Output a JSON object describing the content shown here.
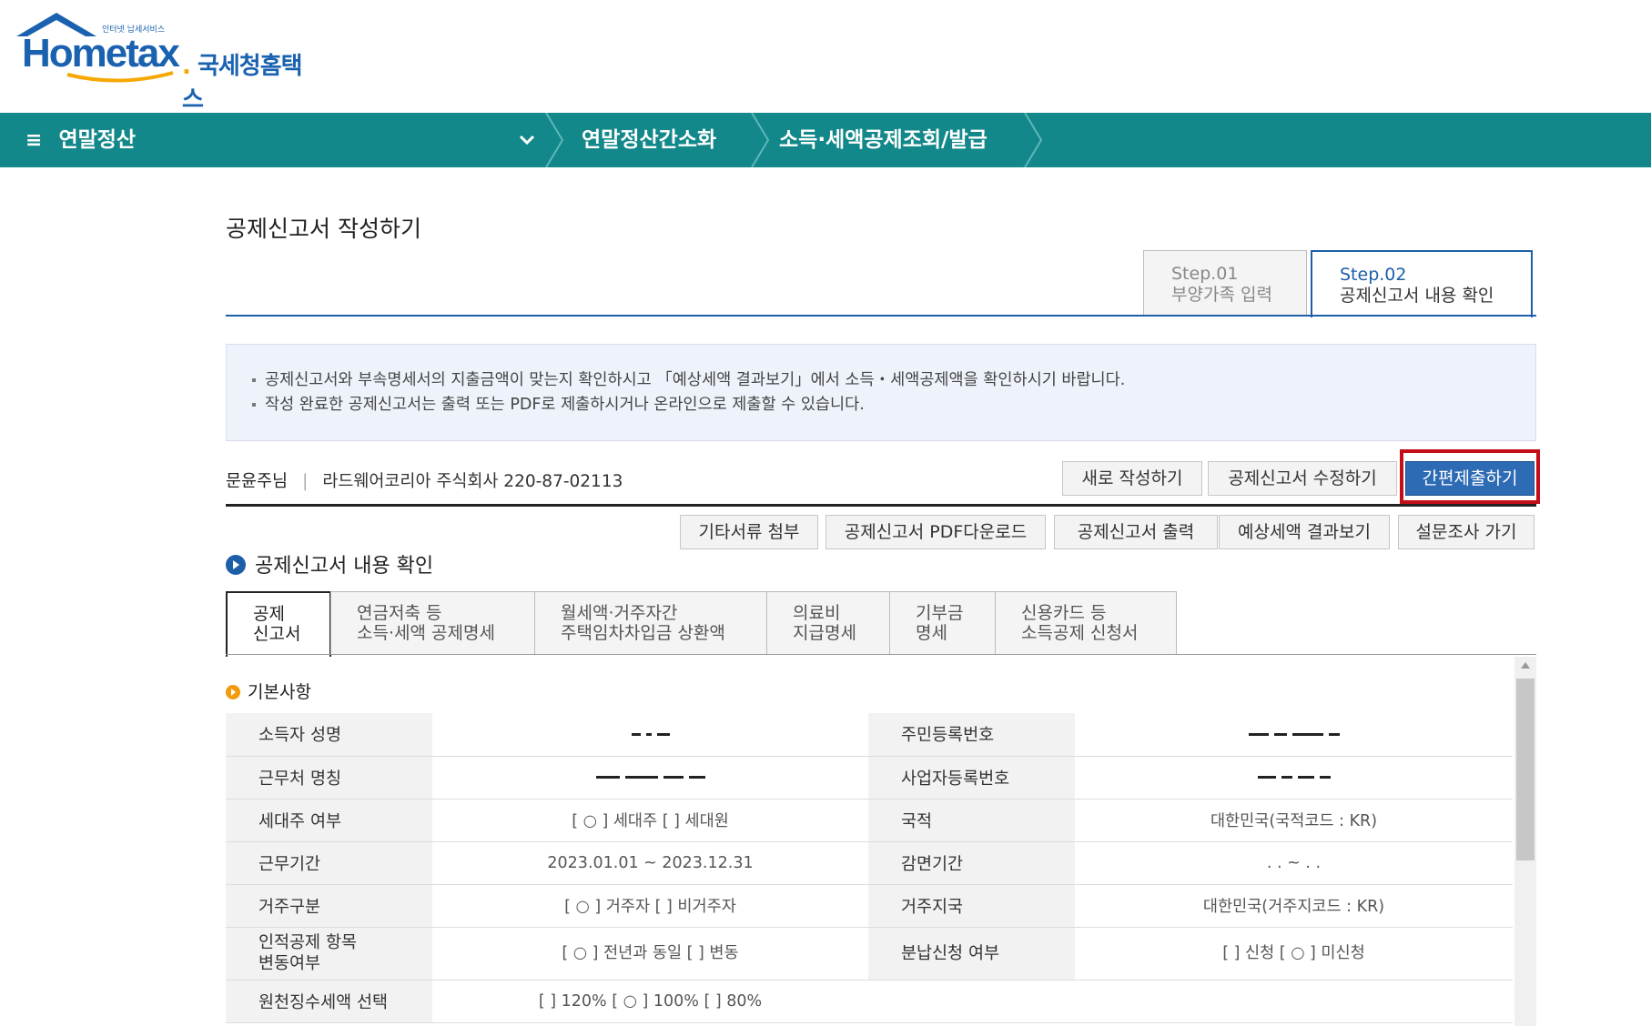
{
  "brand": {
    "logo_word": "Hometax",
    "tagline": "인터넷 납세서비스",
    "kr_name": "국세청홈택스"
  },
  "nav": {
    "menu_label": "연말정산",
    "crumb1": "연말정산간소화",
    "crumb2": "소득·세액공제조회/발급"
  },
  "page": {
    "title": "공제신고서 작성하기"
  },
  "steps": [
    {
      "num": "Step.01",
      "label": "부양가족 입력"
    },
    {
      "num": "Step.02",
      "label": "공제신고서 내용 확인"
    }
  ],
  "notice": [
    "공제신고서와 부속명세서의 지출금액이 맞는지 확인하시고 「예상세액 결과보기」에서 소득・세액공제액을 확인하시기 바랍니다.",
    "작성 완료한 공제신고서는 출력 또는 PDF로 제출하시거나 온라인으로 제출할 수 있습니다."
  ],
  "user": {
    "name": "문윤주님",
    "company": "라드웨어코리아 주식회사 220-87-02113"
  },
  "actions_top": {
    "new": "새로 작성하기",
    "edit": "공제신고서 수정하기",
    "submit": "간편제출하기"
  },
  "actions_bottom": {
    "attach": "기타서류 첨부",
    "pdf": "공제신고서 PDF다운로드",
    "print": "공제신고서 출력",
    "estimate": "예상세액 결과보기",
    "survey": "설문조사 가기"
  },
  "section": {
    "title": "공제신고서 내용 확인"
  },
  "tabs": [
    {
      "l1": "공제",
      "l2": "신고서"
    },
    {
      "l1": "연금저축 등",
      "l2": "소득·세액 공제명세"
    },
    {
      "l1": "월세액·거주자간",
      "l2": "주택임차차입금 상환액"
    },
    {
      "l1": "의료비",
      "l2": "지급명세"
    },
    {
      "l1": "기부금",
      "l2": "명세"
    },
    {
      "l1": "신용카드 등",
      "l2": "소득공제 신청서"
    }
  ],
  "basic": {
    "title": "기본사항",
    "rows": [
      {
        "l1": "소득자 성명",
        "v1": "",
        "l2": "주민등록번호",
        "v2": ""
      },
      {
        "l1": "근무처 명칭",
        "v1": "",
        "l2": "사업자등록번호",
        "v2": ""
      },
      {
        "l1": "세대주 여부",
        "v1": "[ ○ ] 세대주   [     ] 세대원",
        "l2": "국적",
        "v2": "대한민국(국적코드 : KR)"
      },
      {
        "l1": "근무기간",
        "v1": "2023.01.01 ~ 2023.12.31",
        "l2": "감면기간",
        "v2": ". . ~ . ."
      },
      {
        "l1": "거주구분",
        "v1": "[ ○ ] 거주자   [     ] 비거주자",
        "l2": "거주지국",
        "v2": "대한민국(거주지코드 : KR)"
      },
      {
        "l1a": "인적공제 항목",
        "l1b": "변동여부",
        "v1": "[ ○ ] 전년과 동일   [     ] 변동",
        "l2": "분납신청 여부",
        "v2": "[     ] 신청  [ ○ ] 미신청"
      },
      {
        "l1": "원천징수세액 선택",
        "v1": "[     ] 120%   [ ○ ] 100%  [     ] 80%",
        "l2": "",
        "v2": ""
      }
    ]
  },
  "colors": {
    "nav_bg": "#13888a",
    "brand_blue": "#1a62b0",
    "primary_btn": "#2e6bb5",
    "highlight": "#c30d17"
  }
}
